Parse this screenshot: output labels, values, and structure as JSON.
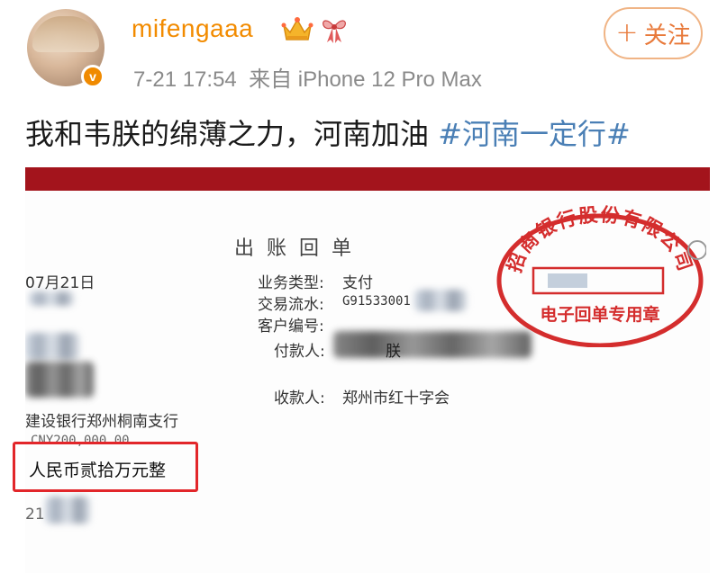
{
  "post": {
    "username": "mifengaaa",
    "time": "7-21 17:54",
    "source": "来自 iPhone 12 Pro Max",
    "follow_label": "关注",
    "follow_plus": "+",
    "verified_mark": "v",
    "text": "我和韦朕的绵薄之力，河南加油 ",
    "hashtag": "#河南一定行#"
  },
  "receipt": {
    "title": "出账回单",
    "date": "07月21日",
    "business_type_label": "业务类型:",
    "business_type_value": "支付",
    "serial_label": "交易流水:",
    "serial_value": "G91533001",
    "client_no_label": "客户编号:",
    "payer_label": "付款人:",
    "payer_visible": "朕",
    "payee_label": "收款人:",
    "payee_value": "郑州市红十字会",
    "bank": "建设银行郑州桐南支行",
    "amount_numeric": "CNY200,000.00",
    "amount_text": "人民币贰拾万元整",
    "partial_number": "21",
    "stamp_top": "招商银行股份有限公司",
    "stamp_bottom": "电子回单专用章"
  },
  "colors": {
    "username": "#f28b00",
    "hashtag": "#4a7fb5",
    "stamp": "#d42d2d",
    "highlight": "#e2262a",
    "red_bar": "#a3141c"
  },
  "icons": [
    "crown-icon",
    "ribbon-icon",
    "verified-badge-icon",
    "plus-icon"
  ]
}
